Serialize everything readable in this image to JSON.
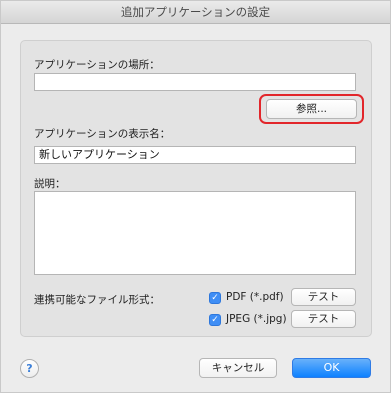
{
  "window": {
    "title": "追加アプリケーションの設定"
  },
  "location": {
    "label": "アプリケーションの場所：",
    "value": "",
    "browse_label": "参照..."
  },
  "display_name": {
    "label": "アプリケーションの表示名：",
    "value": "新しいアプリケーション"
  },
  "description": {
    "label": "説明：",
    "value": ""
  },
  "formats": {
    "label": "連携可能なファイル形式：",
    "items": [
      {
        "label": "PDF (*.pdf)",
        "checked": true,
        "test_label": "テスト"
      },
      {
        "label": "JPEG (*.jpg)",
        "checked": true,
        "test_label": "テスト"
      }
    ]
  },
  "footer": {
    "help_icon_text": "?",
    "cancel_label": "キャンセル",
    "ok_label": "OK"
  },
  "colors": {
    "accent": "#0d81ff",
    "highlight": "#e2262b"
  }
}
